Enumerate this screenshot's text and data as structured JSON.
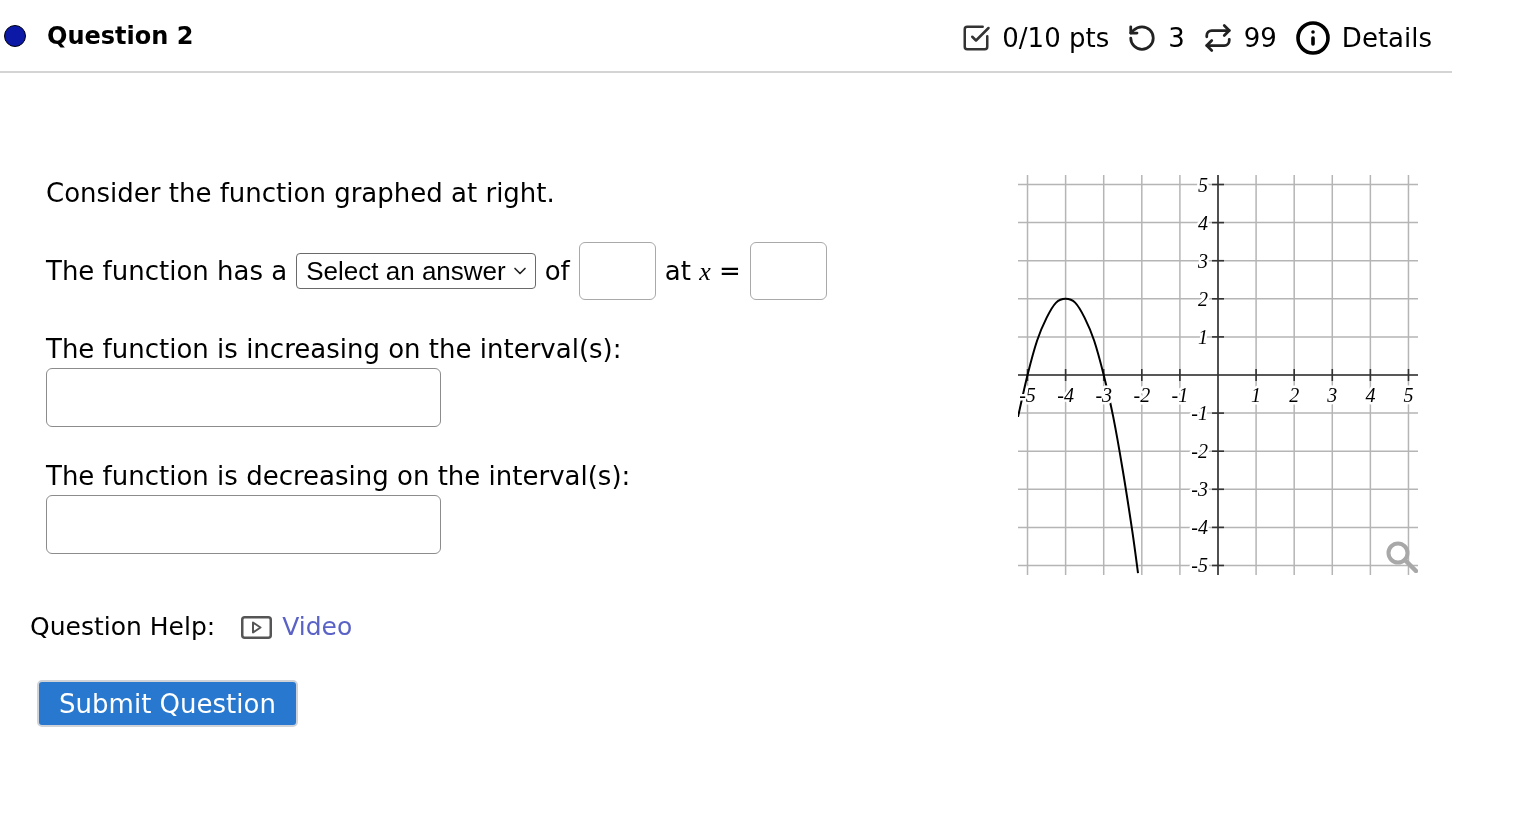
{
  "header": {
    "title": "Question 2",
    "score": "0/10 pts",
    "retries": "3",
    "versions": "99",
    "details": "Details"
  },
  "question": {
    "prompt": "Consider the function graphed at right.",
    "answer_line": [
      {
        "kind": "text",
        "text": "The function has a"
      },
      {
        "kind": "select",
        "placeholder": "Select an answer"
      },
      {
        "kind": "text",
        "text": "of"
      },
      {
        "kind": "input"
      },
      {
        "kind": "text",
        "text": "at *x* ="
      },
      {
        "kind": "input"
      }
    ],
    "interval_questions": [
      {
        "label": "The function is increasing on the interval(s):"
      },
      {
        "label": "The function is decreasing on the interval(s):"
      }
    ],
    "graph": {
      "chart_data": [
        {
          "type": "line",
          "x": [
            -5.25,
            -5,
            -4.75,
            -4.5,
            -4.25,
            -4,
            -3.75,
            -3.5,
            -3.25,
            -3,
            -2.75,
            -2.5,
            -2.25,
            -2.1
          ],
          "values": [
            -1.1,
            0,
            0.9,
            1.5,
            1.9,
            2,
            1.9,
            1.5,
            0.9,
            0,
            -1.1,
            -2.5,
            -4.1,
            -5.2
          ],
          "color": "#000000",
          "xlim": [
            -5.25,
            5.25
          ],
          "ylim": [
            -5.25,
            5.25
          ],
          "xticks": [
            -5,
            -4,
            -3,
            -2,
            -1,
            1,
            2,
            3,
            4,
            5
          ],
          "yticks": [
            -5,
            -4,
            -3,
            -2,
            -1,
            1,
            2,
            3,
            4,
            5
          ],
          "grid": true
        }
      ]
    }
  },
  "help": {
    "label": "Question Help:",
    "link": "Video"
  },
  "submit": {
    "label": "Submit Question"
  }
}
